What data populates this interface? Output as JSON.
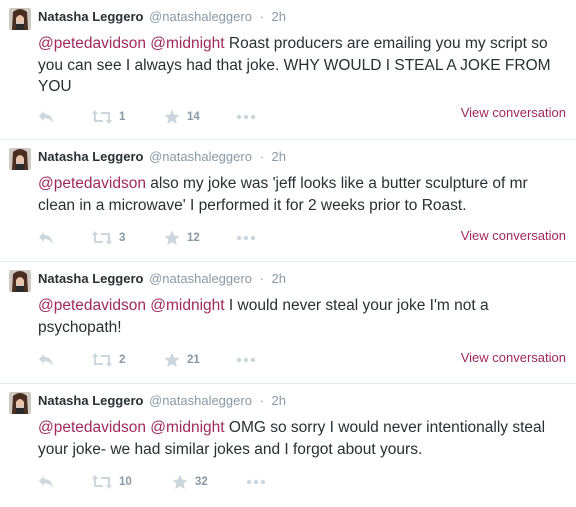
{
  "colors": {
    "accent": "#a0295b",
    "meta": "#8899a6",
    "text": "#292f33",
    "border": "#e1e8ed"
  },
  "tweets": [
    {
      "name": "Natasha Leggero",
      "handle": "@natashaleggero",
      "sep": "·",
      "time": "2h",
      "mention1": "@petedavidson",
      "mention2": "@midnight",
      "body": "Roast producers are emailing you my script so you can see I always had that joke. WHY WOULD I STEAL A JOKE FROM YOU",
      "retweets": "1",
      "favorites": "14",
      "view": "View conversation"
    },
    {
      "name": "Natasha Leggero",
      "handle": "@natashaleggero",
      "sep": "·",
      "time": "2h",
      "mention1": "@petedavidson",
      "body": "also my joke was 'jeff looks like a butter sculpture of mr clean in a microwave' I performed it for 2 weeks prior to Roast.",
      "retweets": "3",
      "favorites": "12",
      "view": "View conversation"
    },
    {
      "name": "Natasha Leggero",
      "handle": "@natashaleggero",
      "sep": "·",
      "time": "2h",
      "mention1": "@petedavidson",
      "mention2": "@midnight",
      "body": "I would never steal your joke I'm not a psychopath!",
      "retweets": "2",
      "favorites": "21",
      "view": "View conversation"
    },
    {
      "name": "Natasha Leggero",
      "handle": "@natashaleggero",
      "sep": "·",
      "time": "2h",
      "mention1": "@petedavidson",
      "mention2": "@midnight",
      "body": "OMG so sorry I would never intentionally steal your joke- we had similar jokes and I forgot about yours.",
      "retweets": "10",
      "favorites": "32"
    }
  ]
}
